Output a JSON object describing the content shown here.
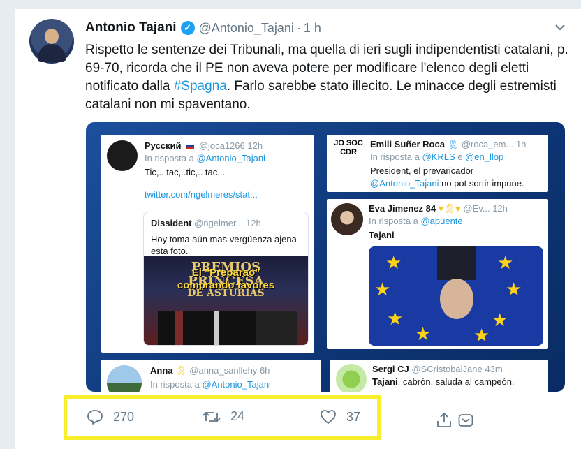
{
  "tweet": {
    "author_name": "Antonio Tajani",
    "handle": "@Antonio_Tajani",
    "dot": "·",
    "time": "1 h",
    "text_before": "Rispetto le sentenze dei Tribunali, ma quella di ieri sugli indipendentisti catalani, p. 69-70, ricorda che il PE non aveva potere per modificare l'elenco degli eletti notificato dalla ",
    "hashtag": "#Spagna",
    "text_after": ". Farlo sarebbe stato illecito. Le minacce degli estremisti catalani non mi spaventano."
  },
  "media": {
    "card1": {
      "name": "Русский",
      "handle": "@joca1266",
      "time": "12h",
      "reply_prefix": "In risposta a",
      "reply_to": "@Antonio_Tajani",
      "body": "Tic,.. tac,..tic,.. tac...",
      "link": "twitter.com/ngelmeres/stat...",
      "quoted": {
        "name": "Dissident",
        "handle": "@ngelmer...",
        "time": "12h",
        "body": "Hoy toma aún mas vergüenza ajena esta foto.",
        "photo_line1": "PREMIOS",
        "photo_line2": "PRINCESA",
        "photo_line3": "DE ASTURIAS",
        "photo_overlay1": "El \"Preparao\"",
        "photo_overlay2": "comprando favores"
      }
    },
    "card2": {
      "avatar_text": "JO SOC CDR",
      "name": "Emili Suñer Roca",
      "handle": "@roca_em...",
      "time": "1h",
      "reply_prefix": "In risposta a",
      "reply_to1": "@KRLS",
      "reply_and": "e",
      "reply_to2": "@en_llop",
      "body": "President, el prevaricador",
      "mention": "@Antonio_Tajani",
      "body_after": "no pot sortir impune."
    },
    "card3": {
      "name": "Eva Jimenez 84",
      "handle": "@Ev...",
      "time": "12h",
      "reply_prefix": "In risposta a",
      "reply_to": "@apuente",
      "body": "Tajani"
    },
    "card4": {
      "name": "Anna",
      "handle": "@anna_sanllehy",
      "time": "6h",
      "reply_prefix": "In risposta a",
      "reply_to": "@Antonio_Tajani"
    },
    "card5": {
      "name": "Sergi CJ",
      "handle": "@SCristobalJane",
      "time": "43m",
      "body_bold": "Tajani",
      "body": ", cabrón, saluda al campeón."
    }
  },
  "actions": {
    "reply_count": "270",
    "retweet_count": "24",
    "like_count": "37"
  },
  "colors": {
    "link_blue": "#1b95e0",
    "highlight_yellow": "#f7ef2b",
    "verified_blue": "#1da1f2"
  }
}
